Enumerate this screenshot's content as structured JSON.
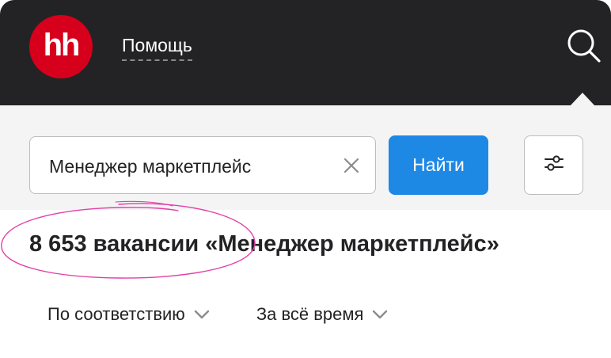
{
  "header": {
    "logo_text": "hh",
    "help_label": "Помощь",
    "search_icon": "search-icon",
    "brand_color": "#d6001c"
  },
  "search": {
    "value": "Менеджер маркетплейс",
    "clear_icon": "close-icon",
    "submit_label": "Найти",
    "filter_icon": "filter-sliders-icon"
  },
  "results": {
    "title": "8 653 вакансии «Менеджер маркетплейс»"
  },
  "sort": {
    "relevance_label": "По соответствию",
    "period_label": "За всё время"
  },
  "colors": {
    "header_bg": "#232325",
    "panel_bg": "#f4f4f5",
    "accent_blue": "#1e88e5",
    "annotation_pink": "#e23fa6"
  }
}
